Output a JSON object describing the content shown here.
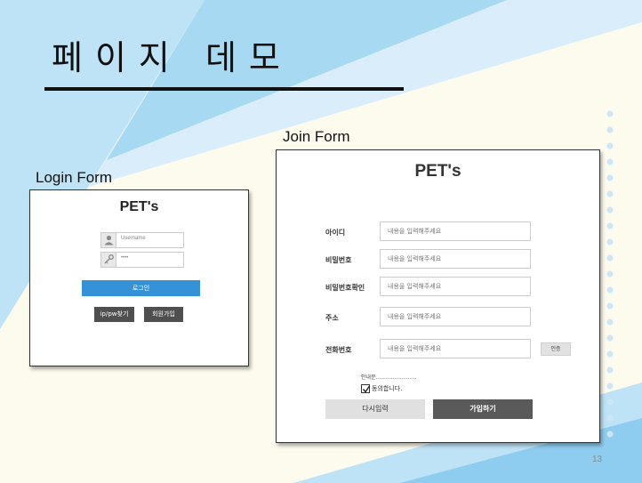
{
  "slide": {
    "title": "페이지 데모",
    "page_number": "13",
    "colors": {
      "accent_light": "#bfe3f6",
      "accent": "#8fcdf0",
      "background": "#fdfbee"
    }
  },
  "login": {
    "section_label": "Login Form",
    "brand": "PET's",
    "username_value": "Username",
    "password_value": "••••",
    "login_button": "로그인",
    "find_button": "ip/pw찾기",
    "signup_button": "회원가입",
    "icons": {
      "username": "user-icon",
      "password": "key-icon"
    }
  },
  "join": {
    "section_label": "Join Form",
    "brand": "PET's",
    "placeholder": "내용을 입력해주세요",
    "rows": [
      {
        "label": "아이디"
      },
      {
        "label": "비밀번호"
      },
      {
        "label": "비밀번호확인"
      },
      {
        "label": "주소"
      },
      {
        "label": "전화번호"
      }
    ],
    "cert_button": "인증",
    "notice": "안내문........................",
    "agree_label": "동의합니다.",
    "agree_checked": true,
    "reset_button": "다시입력",
    "join_button": "가입하기"
  }
}
